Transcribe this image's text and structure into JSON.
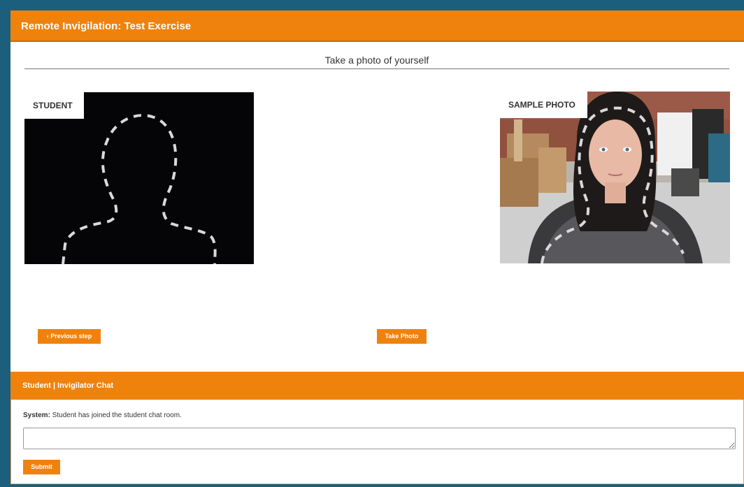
{
  "header": {
    "title": "Remote Invigilation: Test Exercise"
  },
  "main": {
    "heading": "Take a photo of yourself",
    "student_label": "STUDENT",
    "sample_label": "SAMPLE PHOTO",
    "prev_button": "‹ Previous step",
    "take_photo_button": "Take Photo"
  },
  "chat": {
    "title": "Student | Invigilator Chat",
    "messages": [
      {
        "sender": "System:",
        "text": " Student has joined the student chat room."
      }
    ],
    "input_value": "",
    "submit_label": "Submit"
  },
  "colors": {
    "accent": "#ef820d",
    "outer_border": "#1b5f7d",
    "camera_bg": "#050507",
    "outline_dash": "#d9d9d9"
  },
  "icons": {
    "student_placeholder": "person-silhouette-outline-icon",
    "sample_photo_outline": "person-silhouette-outline-icon"
  }
}
